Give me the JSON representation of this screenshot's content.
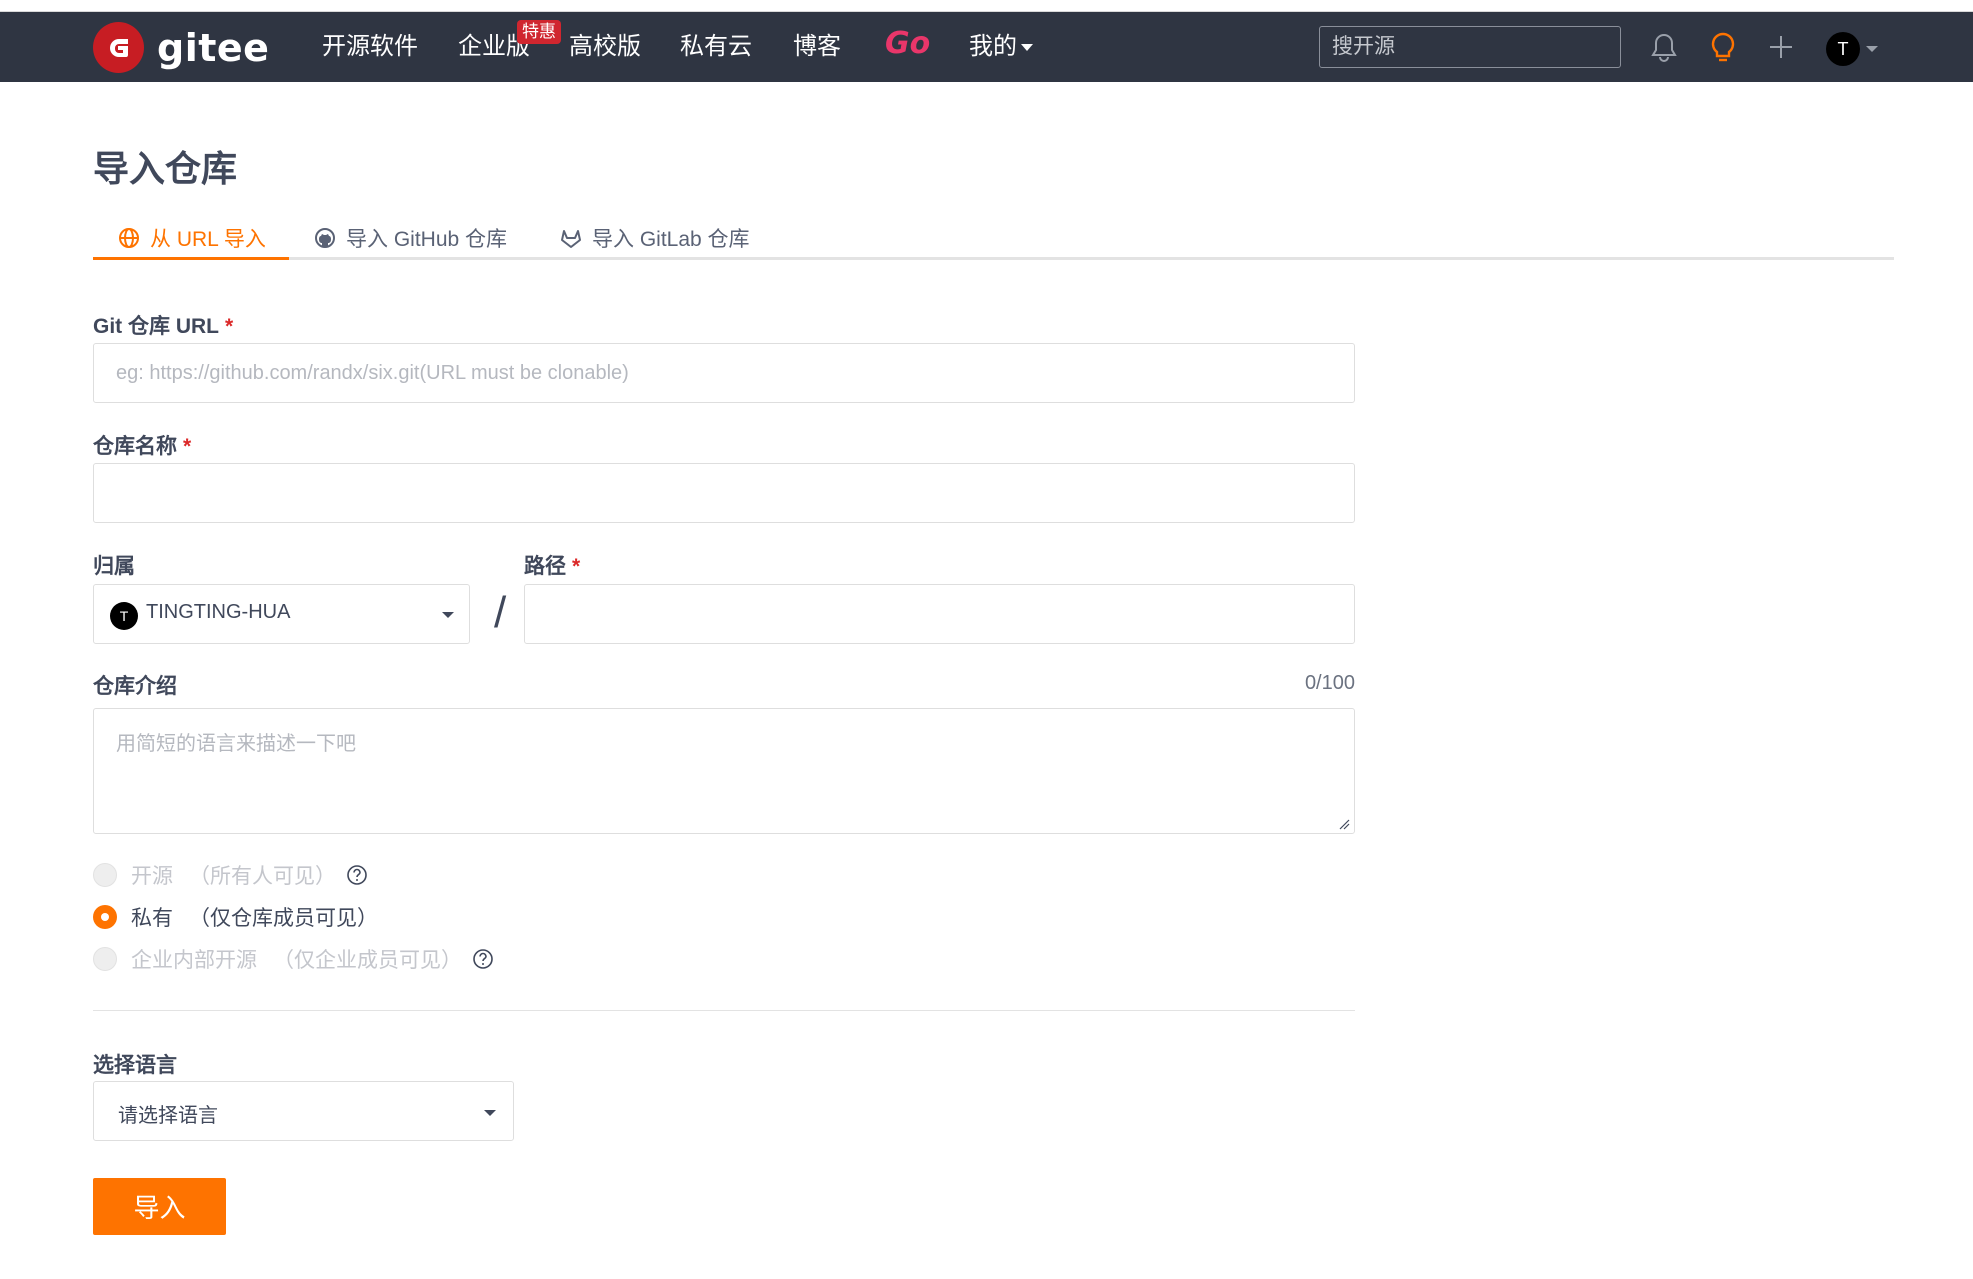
{
  "navbar": {
    "logo_text": "gitee",
    "items": [
      "开源软件",
      "企业版",
      "高校版",
      "私有云",
      "博客"
    ],
    "hot_badge": "特惠",
    "go_label": "Go",
    "mine_label": "我的",
    "search_placeholder": "搜开源",
    "avatar_initial": "T"
  },
  "page": {
    "title": "导入仓库"
  },
  "tabs": [
    {
      "label": "从 URL 导入",
      "active": true
    },
    {
      "label": "导入 GitHub 仓库",
      "active": false
    },
    {
      "label": "导入 GitLab 仓库",
      "active": false
    }
  ],
  "form": {
    "url_label": "Git 仓库 URL",
    "url_placeholder": "eg: https://github.com/randx/six.git(URL must be clonable)",
    "url_value": "",
    "name_label": "仓库名称",
    "name_value": "",
    "owner_label": "归属",
    "owner_avatar_initial": "T",
    "owner_value": "TINGTING-HUA",
    "slash": "/",
    "path_label": "路径",
    "path_value": "",
    "required_mark": "*",
    "desc_label": "仓库介绍",
    "desc_counter": "0/100",
    "desc_placeholder": "用简短的语言来描述一下吧",
    "visibility": [
      {
        "label": "开源",
        "note": "（所有人可见）",
        "selected": false,
        "disabled": true,
        "help": true
      },
      {
        "label": "私有",
        "note": "（仅仓库成员可见）",
        "selected": true,
        "disabled": false,
        "help": false
      },
      {
        "label": "企业内部开源",
        "note": "（仅企业成员可见）",
        "selected": false,
        "disabled": true,
        "help": true
      }
    ],
    "language_label": "选择语言",
    "language_value": "请选择语言",
    "submit_label": "导入"
  },
  "colors": {
    "navbar_bg": "#2f3542",
    "accent": "#fe7300",
    "logo_red": "#c71d23",
    "required_red": "#db2828",
    "go_pink": "#e9366a"
  }
}
